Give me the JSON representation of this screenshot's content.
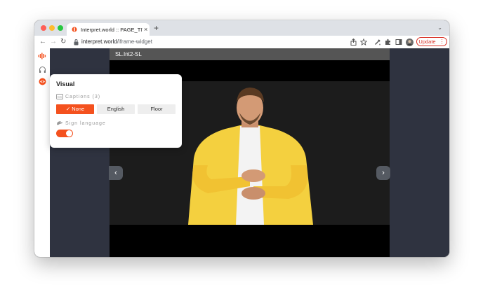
{
  "browser": {
    "tab_title": "Interpret.world :: PAGE_TITTLE",
    "tab_close": "×",
    "new_tab": "+",
    "url_host": "interpret.world",
    "url_path": "/iframe-widget",
    "update_label": "Update",
    "update_menu": "⋮",
    "tab_menu": "⌄"
  },
  "video": {
    "header_title": "SL.Int2-SL",
    "prev_arrow": "‹",
    "next_arrow": "›"
  },
  "popup": {
    "title": "Visual",
    "captions_label": "Captions (3)",
    "caption_options": [
      {
        "label": "None",
        "selected": true
      },
      {
        "label": "English",
        "selected": false
      },
      {
        "label": "Floor",
        "selected": false
      }
    ],
    "sign_language_label": "Sign language",
    "sign_language_enabled": true
  },
  "colors": {
    "accent": "#f4511e",
    "panel_bg": "#2f3340",
    "update_red": "#d93025"
  },
  "icons": {
    "sidebar": [
      "interpret-logo-icon",
      "headphones-icon",
      "eye-icon"
    ],
    "toolbar": [
      "share-icon",
      "star-icon",
      "eyedropper-icon",
      "puzzle-icon",
      "sidepanel-icon",
      "profile-avatar"
    ]
  }
}
